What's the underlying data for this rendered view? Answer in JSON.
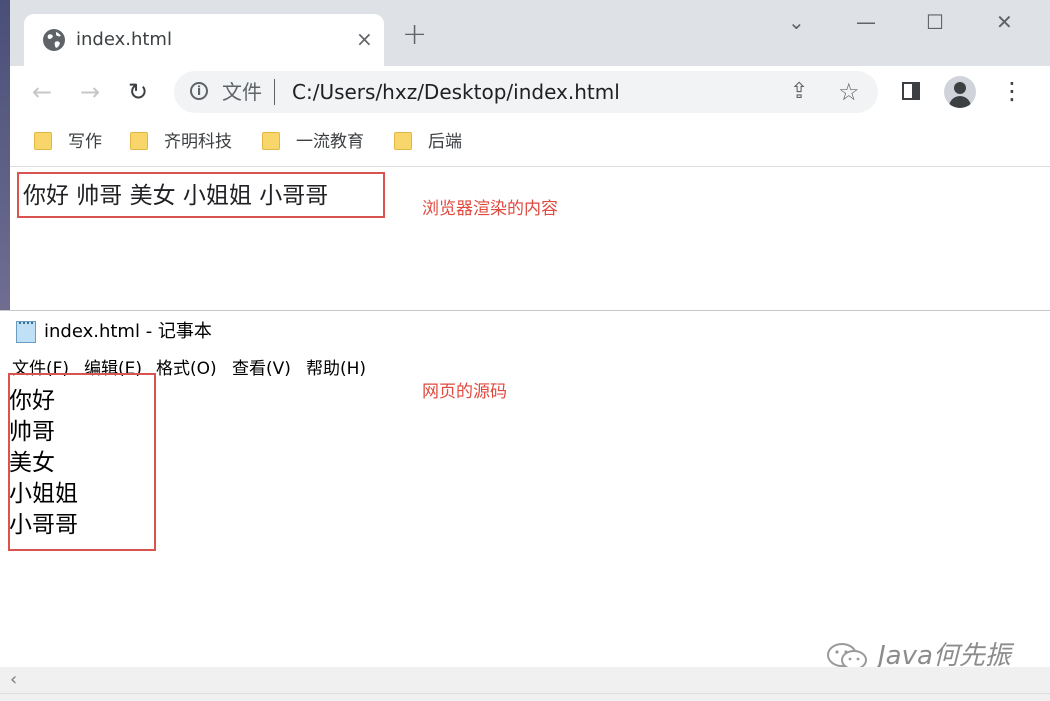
{
  "browser": {
    "tab": {
      "title": "index.html",
      "close_icon": "×"
    },
    "new_tab_icon": "+",
    "window_controls": {
      "dropdown": "⌄",
      "minimize": "—",
      "maximize": "☐",
      "close": "✕"
    },
    "toolbar": {
      "back": "←",
      "forward": "→",
      "reload": "↻",
      "scheme_label": "文件",
      "url": "C:/Users/hxz/Desktop/index.html",
      "share": "⇪",
      "star": "☆",
      "menu": "⋮"
    },
    "bookmarks": [
      {
        "label": "写作"
      },
      {
        "label": "齐明科技"
      },
      {
        "label": "一流教育"
      },
      {
        "label": "后端"
      }
    ],
    "page_text": "你好 帅哥 美女 小姐姐 小哥哥"
  },
  "annotations": {
    "browser_note": "浏览器渲染的内容",
    "source_note": "网页的源码"
  },
  "notepad": {
    "title": "index.html - 记事本",
    "menu": [
      "文件(F)",
      "编辑(E)",
      "格式(O)",
      "查看(V)",
      "帮助(H)"
    ],
    "lines": [
      "你好",
      "帅哥",
      "美女",
      "小姐姐",
      "小哥哥"
    ],
    "scroll_left": "‹"
  },
  "watermark": {
    "text": "Java何先振"
  },
  "colors": {
    "annotation_red": "#d9534f",
    "tabstrip": "#dee1e6",
    "folder": "#f9d66b"
  }
}
